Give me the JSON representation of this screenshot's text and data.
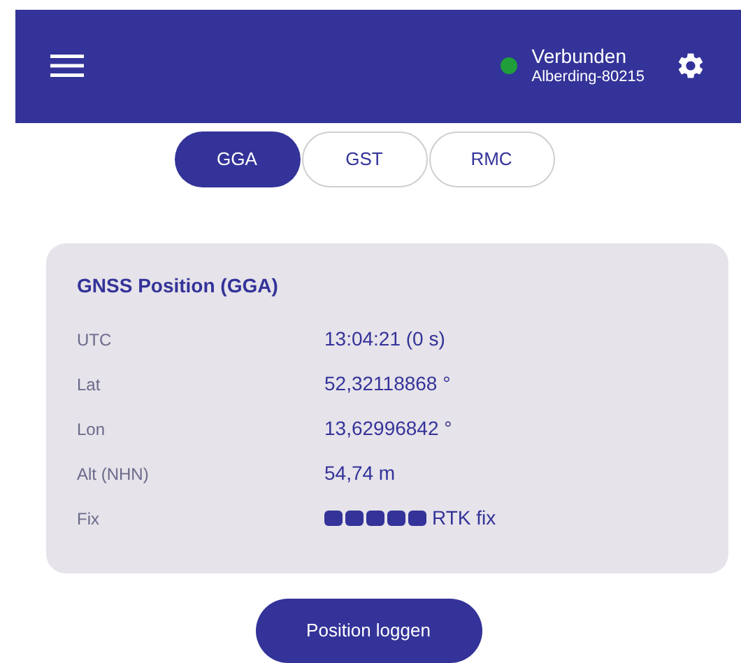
{
  "header": {
    "status": {
      "connected": true,
      "label": "Verbunden",
      "device": "Alberding-80215"
    }
  },
  "tabs": [
    {
      "label": "GGA",
      "selected": true
    },
    {
      "label": "GST",
      "selected": false
    },
    {
      "label": "RMC",
      "selected": false
    }
  ],
  "card": {
    "title": "GNSS Position (GGA)",
    "rows": [
      {
        "kind": "text",
        "label": "UTC",
        "value": "13:04:21 (0 s)"
      },
      {
        "kind": "text",
        "label": "Lat",
        "value": "52,32118868 °"
      },
      {
        "kind": "text",
        "label": "Lon",
        "value": "13,62996842 °"
      },
      {
        "kind": "text",
        "label": "Alt (NHN)",
        "value": "54,74 m"
      },
      {
        "kind": "quality",
        "label": "Fix",
        "stars": 5,
        "value": "RTK fix"
      }
    ]
  },
  "button": "Position loggen"
}
